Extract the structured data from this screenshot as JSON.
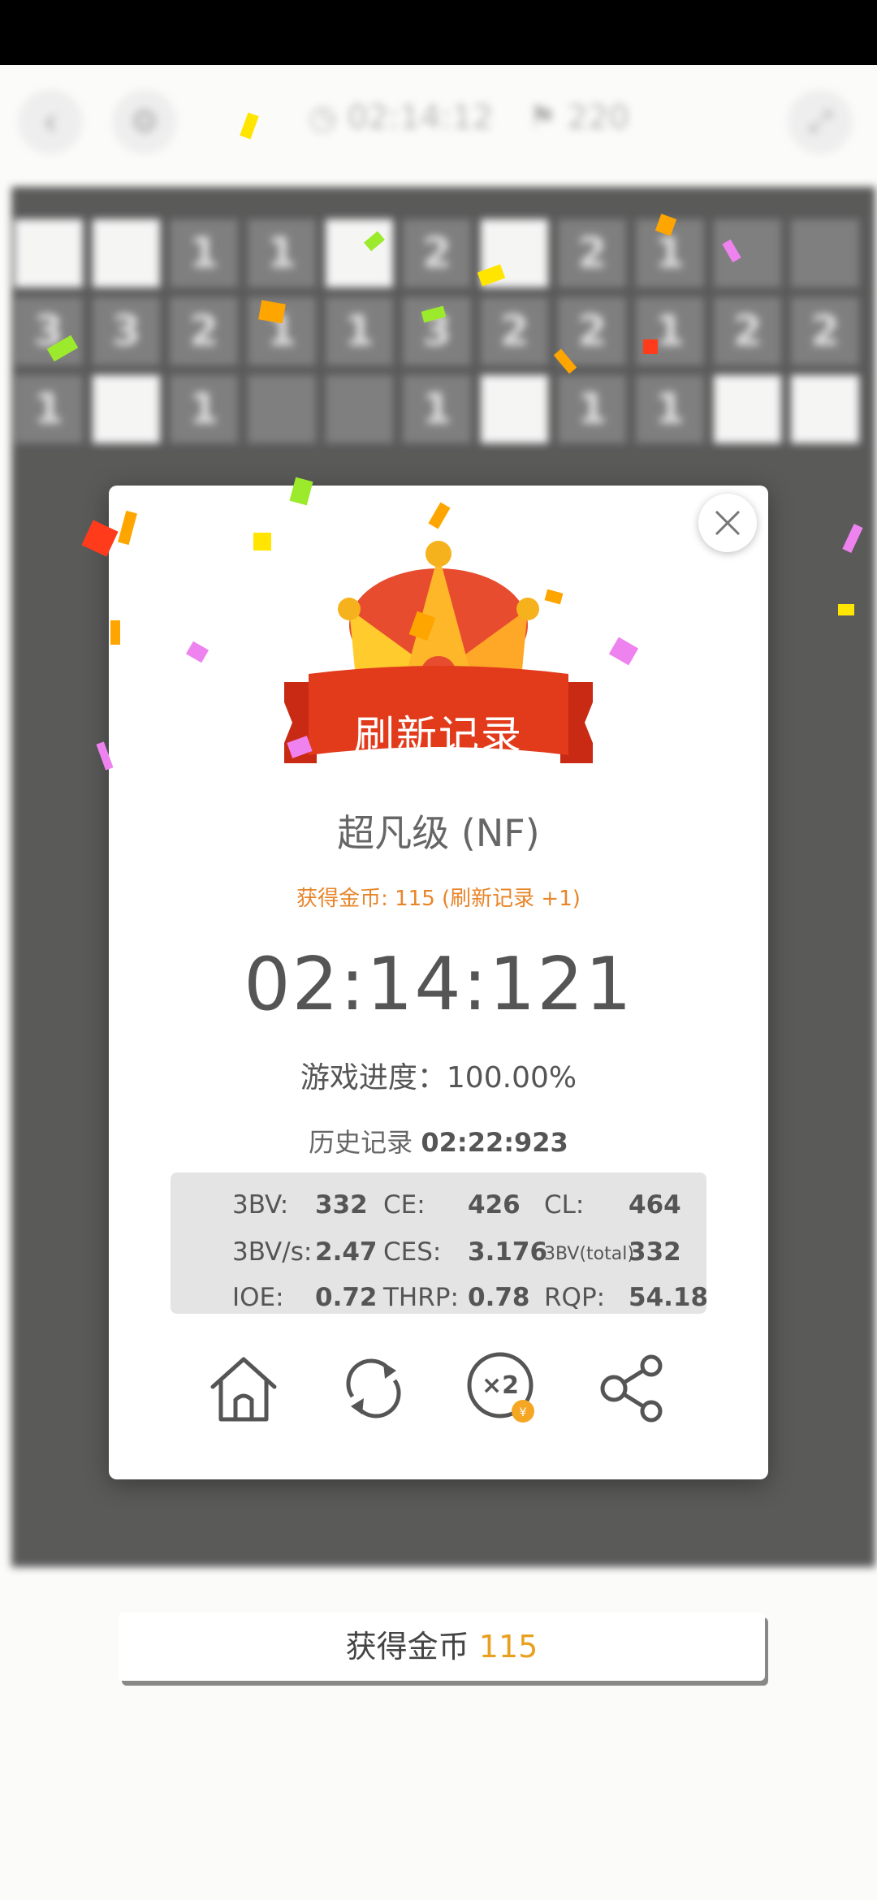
{
  "game_bar": {
    "timer": "02:14:12",
    "flags": "220"
  },
  "board": {
    "rows": [
      [
        "",
        "",
        "1",
        "1",
        "",
        "2",
        "",
        "2",
        "1",
        "",
        ""
      ],
      [
        "3",
        "3",
        "2",
        "1",
        "1",
        "3",
        "2",
        "2",
        "1",
        "2",
        "2"
      ],
      [
        "1",
        "",
        "1",
        "",
        "",
        "1",
        "",
        "1",
        "1",
        "",
        ""
      ]
    ],
    "open_cells": [
      [
        0,
        0
      ],
      [
        0,
        1
      ],
      [
        0,
        4
      ],
      [
        0,
        6
      ],
      [
        2,
        1
      ],
      [
        2,
        6
      ],
      [
        2,
        9
      ],
      [
        2,
        10
      ]
    ]
  },
  "modal": {
    "banner": "刷新记录",
    "level": "超凡级 (NF)",
    "coins_line": "获得金币: 115 (刷新记录 +1)",
    "time": "02:14:121",
    "progress": "游戏进度：100.00%",
    "history_label": "历史记录",
    "history_value": "02:22:923",
    "stats": [
      [
        {
          "label": "3BV:",
          "value": "332"
        },
        {
          "label": "CE:",
          "value": "426"
        },
        {
          "label": "CL:",
          "value": "464"
        }
      ],
      [
        {
          "label": "3BV/s:",
          "value": "2.47"
        },
        {
          "label": "CES:",
          "value": "3.176"
        },
        {
          "label": "3BV(total):",
          "value": "332"
        }
      ],
      [
        {
          "label": "IOE:",
          "value": "0.72"
        },
        {
          "label": "THRP:",
          "value": "0.78"
        },
        {
          "label": "RQP:",
          "value": "54.18"
        }
      ]
    ],
    "actions": [
      "home-icon",
      "restart-icon",
      "double-coins-icon",
      "share-icon"
    ]
  },
  "coin_button": {
    "label": "获得金币",
    "amount": "115"
  },
  "colors": {
    "accent_orange": "#e8852a",
    "banner_red": "#e23b1c",
    "crown_gold": "#ffc22b",
    "coin_amount": "#e8a020"
  }
}
